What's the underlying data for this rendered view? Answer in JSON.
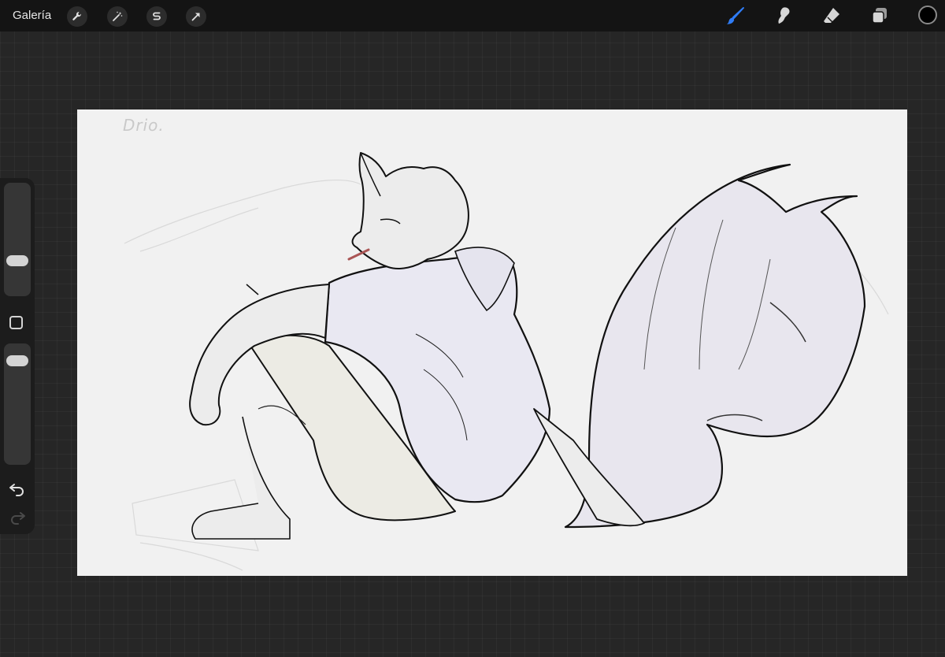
{
  "toolbar": {
    "gallery_label": "Galería",
    "left_tools": [
      "wrench-icon",
      "magic-wand-icon",
      "selection-icon",
      "transform-arrow-icon"
    ],
    "right_tools": [
      "brush-icon",
      "smudge-icon",
      "eraser-icon",
      "layers-icon"
    ],
    "active_tool": "brush",
    "active_tool_color": "#2f7cf6",
    "current_color": "#000000"
  },
  "sidebar": {
    "brush_size_level": 0.28,
    "opacity_level": 0.92
  },
  "canvas": {
    "background": "#f1f1f1",
    "signature_text": "Drio."
  }
}
